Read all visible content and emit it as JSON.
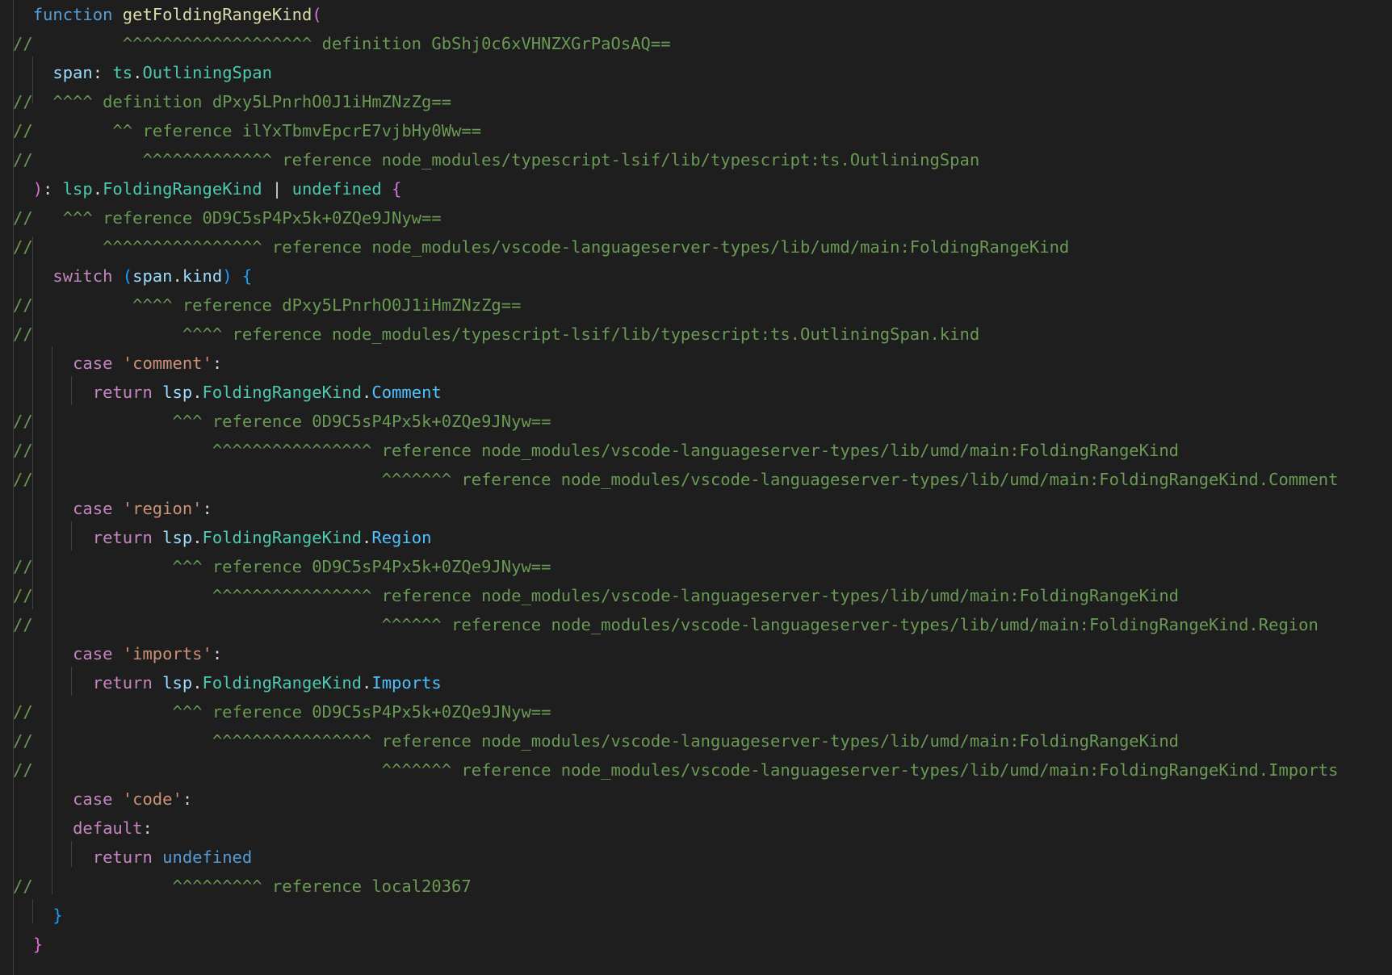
{
  "colors": {
    "background": "#1e1e1e",
    "indent_guide": "#404040",
    "keyword": "#569cd6",
    "control": "#c586c0",
    "function": "#dcdcaa",
    "parameter": "#9cdcfe",
    "type": "#4ec9b0",
    "string": "#ce9178",
    "comment": "#6a9955",
    "punctuation": "#d4d4d4",
    "bracket_level1": "#da70d6",
    "bracket_level2": "#179fff",
    "enum_member": "#4fc1ff"
  },
  "code_lines": [
    {
      "tokens": [
        {
          "t": "  ",
          "c": "punc"
        },
        {
          "t": "function",
          "c": "kw"
        },
        {
          "t": " ",
          "c": "punc"
        },
        {
          "t": "getFoldingRangeKind",
          "c": "fn"
        },
        {
          "t": "(",
          "c": "brk1"
        }
      ]
    },
    {
      "tokens": [
        {
          "t": "//         ^^^^^^^^^^^^^^^^^^^ definition GbShj0c6xVHNZXGrPaOsAQ==",
          "c": "comment"
        }
      ]
    },
    {
      "tokens": [
        {
          "t": "    ",
          "c": "punc"
        },
        {
          "t": "span",
          "c": "param"
        },
        {
          "t": ": ",
          "c": "punc"
        },
        {
          "t": "ts",
          "c": "type"
        },
        {
          "t": ".",
          "c": "punc"
        },
        {
          "t": "OutliningSpan",
          "c": "type"
        }
      ]
    },
    {
      "tokens": [
        {
          "t": "//  ^^^^ definition dPxy5LPnrhO0J1iHmZNzZg==",
          "c": "comment"
        }
      ]
    },
    {
      "tokens": [
        {
          "t": "//        ^^ reference ilYxTbmvEpcrE7vjbHy0Ww==",
          "c": "comment"
        }
      ]
    },
    {
      "tokens": [
        {
          "t": "//           ^^^^^^^^^^^^^ reference node_modules/typescript-lsif/lib/typescript:ts.OutliningSpan",
          "c": "comment"
        }
      ]
    },
    {
      "tokens": [
        {
          "t": "  ",
          "c": "punc"
        },
        {
          "t": ")",
          "c": "brk1"
        },
        {
          "t": ": ",
          "c": "punc"
        },
        {
          "t": "lsp",
          "c": "type"
        },
        {
          "t": ".",
          "c": "punc"
        },
        {
          "t": "FoldingRangeKind",
          "c": "type"
        },
        {
          "t": " | ",
          "c": "punc"
        },
        {
          "t": "undefined",
          "c": "type"
        },
        {
          "t": " ",
          "c": "punc"
        },
        {
          "t": "{",
          "c": "brk1"
        }
      ]
    },
    {
      "tokens": [
        {
          "t": "//   ^^^ reference 0D9C5sP4Px5k+0ZQe9JNyw==",
          "c": "comment"
        }
      ]
    },
    {
      "tokens": [
        {
          "t": "//       ^^^^^^^^^^^^^^^^ reference node_modules/vscode-languageserver-types/lib/umd/main:FoldingRangeKind",
          "c": "comment"
        }
      ]
    },
    {
      "tokens": [
        {
          "t": "    ",
          "c": "punc"
        },
        {
          "t": "switch",
          "c": "ctrl"
        },
        {
          "t": " ",
          "c": "punc"
        },
        {
          "t": "(",
          "c": "brk2"
        },
        {
          "t": "span",
          "c": "param"
        },
        {
          "t": ".",
          "c": "punc"
        },
        {
          "t": "kind",
          "c": "param"
        },
        {
          "t": ")",
          "c": "brk2"
        },
        {
          "t": " ",
          "c": "punc"
        },
        {
          "t": "{",
          "c": "brk2"
        }
      ]
    },
    {
      "tokens": [
        {
          "t": "//          ^^^^ reference dPxy5LPnrhO0J1iHmZNzZg==",
          "c": "comment"
        }
      ]
    },
    {
      "tokens": [
        {
          "t": "//               ^^^^ reference node_modules/typescript-lsif/lib/typescript:ts.OutliningSpan.kind",
          "c": "comment"
        }
      ]
    },
    {
      "tokens": [
        {
          "t": "      ",
          "c": "punc"
        },
        {
          "t": "case",
          "c": "ctrl"
        },
        {
          "t": " ",
          "c": "punc"
        },
        {
          "t": "'comment'",
          "c": "str"
        },
        {
          "t": ":",
          "c": "punc"
        }
      ]
    },
    {
      "tokens": [
        {
          "t": "        ",
          "c": "punc"
        },
        {
          "t": "return",
          "c": "ctrl"
        },
        {
          "t": " ",
          "c": "punc"
        },
        {
          "t": "lsp",
          "c": "param"
        },
        {
          "t": ".",
          "c": "punc"
        },
        {
          "t": "FoldingRangeKind",
          "c": "type"
        },
        {
          "t": ".",
          "c": "punc"
        },
        {
          "t": "Comment",
          "c": "enum"
        }
      ]
    },
    {
      "tokens": [
        {
          "t": "//              ^^^ reference 0D9C5sP4Px5k+0ZQe9JNyw==",
          "c": "comment"
        }
      ]
    },
    {
      "tokens": [
        {
          "t": "//                  ^^^^^^^^^^^^^^^^ reference node_modules/vscode-languageserver-types/lib/umd/main:FoldingRangeKind",
          "c": "comment"
        }
      ]
    },
    {
      "tokens": [
        {
          "t": "//                                   ^^^^^^^ reference node_modules/vscode-languageserver-types/lib/umd/main:FoldingRangeKind.Comment",
          "c": "comment"
        }
      ]
    },
    {
      "tokens": [
        {
          "t": "      ",
          "c": "punc"
        },
        {
          "t": "case",
          "c": "ctrl"
        },
        {
          "t": " ",
          "c": "punc"
        },
        {
          "t": "'region'",
          "c": "str"
        },
        {
          "t": ":",
          "c": "punc"
        }
      ]
    },
    {
      "tokens": [
        {
          "t": "        ",
          "c": "punc"
        },
        {
          "t": "return",
          "c": "ctrl"
        },
        {
          "t": " ",
          "c": "punc"
        },
        {
          "t": "lsp",
          "c": "param"
        },
        {
          "t": ".",
          "c": "punc"
        },
        {
          "t": "FoldingRangeKind",
          "c": "type"
        },
        {
          "t": ".",
          "c": "punc"
        },
        {
          "t": "Region",
          "c": "enum"
        }
      ]
    },
    {
      "tokens": [
        {
          "t": "//              ^^^ reference 0D9C5sP4Px5k+0ZQe9JNyw==",
          "c": "comment"
        }
      ]
    },
    {
      "tokens": [
        {
          "t": "//                  ^^^^^^^^^^^^^^^^ reference node_modules/vscode-languageserver-types/lib/umd/main:FoldingRangeKind",
          "c": "comment"
        }
      ]
    },
    {
      "tokens": [
        {
          "t": "//                                   ^^^^^^ reference node_modules/vscode-languageserver-types/lib/umd/main:FoldingRangeKind.Region",
          "c": "comment"
        }
      ]
    },
    {
      "tokens": [
        {
          "t": "      ",
          "c": "punc"
        },
        {
          "t": "case",
          "c": "ctrl"
        },
        {
          "t": " ",
          "c": "punc"
        },
        {
          "t": "'imports'",
          "c": "str"
        },
        {
          "t": ":",
          "c": "punc"
        }
      ]
    },
    {
      "tokens": [
        {
          "t": "        ",
          "c": "punc"
        },
        {
          "t": "return",
          "c": "ctrl"
        },
        {
          "t": " ",
          "c": "punc"
        },
        {
          "t": "lsp",
          "c": "param"
        },
        {
          "t": ".",
          "c": "punc"
        },
        {
          "t": "FoldingRangeKind",
          "c": "type"
        },
        {
          "t": ".",
          "c": "punc"
        },
        {
          "t": "Imports",
          "c": "enum"
        }
      ]
    },
    {
      "tokens": [
        {
          "t": "//              ^^^ reference 0D9C5sP4Px5k+0ZQe9JNyw==",
          "c": "comment"
        }
      ]
    },
    {
      "tokens": [
        {
          "t": "//                  ^^^^^^^^^^^^^^^^ reference node_modules/vscode-languageserver-types/lib/umd/main:FoldingRangeKind",
          "c": "comment"
        }
      ]
    },
    {
      "tokens": [
        {
          "t": "//                                   ^^^^^^^ reference node_modules/vscode-languageserver-types/lib/umd/main:FoldingRangeKind.Imports",
          "c": "comment"
        }
      ]
    },
    {
      "tokens": [
        {
          "t": "      ",
          "c": "punc"
        },
        {
          "t": "case",
          "c": "ctrl"
        },
        {
          "t": " ",
          "c": "punc"
        },
        {
          "t": "'code'",
          "c": "str"
        },
        {
          "t": ":",
          "c": "punc"
        }
      ]
    },
    {
      "tokens": [
        {
          "t": "      ",
          "c": "punc"
        },
        {
          "t": "default",
          "c": "ctrl"
        },
        {
          "t": ":",
          "c": "punc"
        }
      ]
    },
    {
      "tokens": [
        {
          "t": "        ",
          "c": "punc"
        },
        {
          "t": "return",
          "c": "ctrl"
        },
        {
          "t": " ",
          "c": "punc"
        },
        {
          "t": "undefined",
          "c": "kw"
        }
      ]
    },
    {
      "tokens": [
        {
          "t": "//              ^^^^^^^^^ reference local20367",
          "c": "comment"
        }
      ]
    },
    {
      "tokens": [
        {
          "t": "    ",
          "c": "punc"
        },
        {
          "t": "}",
          "c": "brk2"
        }
      ]
    },
    {
      "tokens": [
        {
          "t": "  ",
          "c": "punc"
        },
        {
          "t": "}",
          "c": "brk1"
        }
      ]
    }
  ]
}
